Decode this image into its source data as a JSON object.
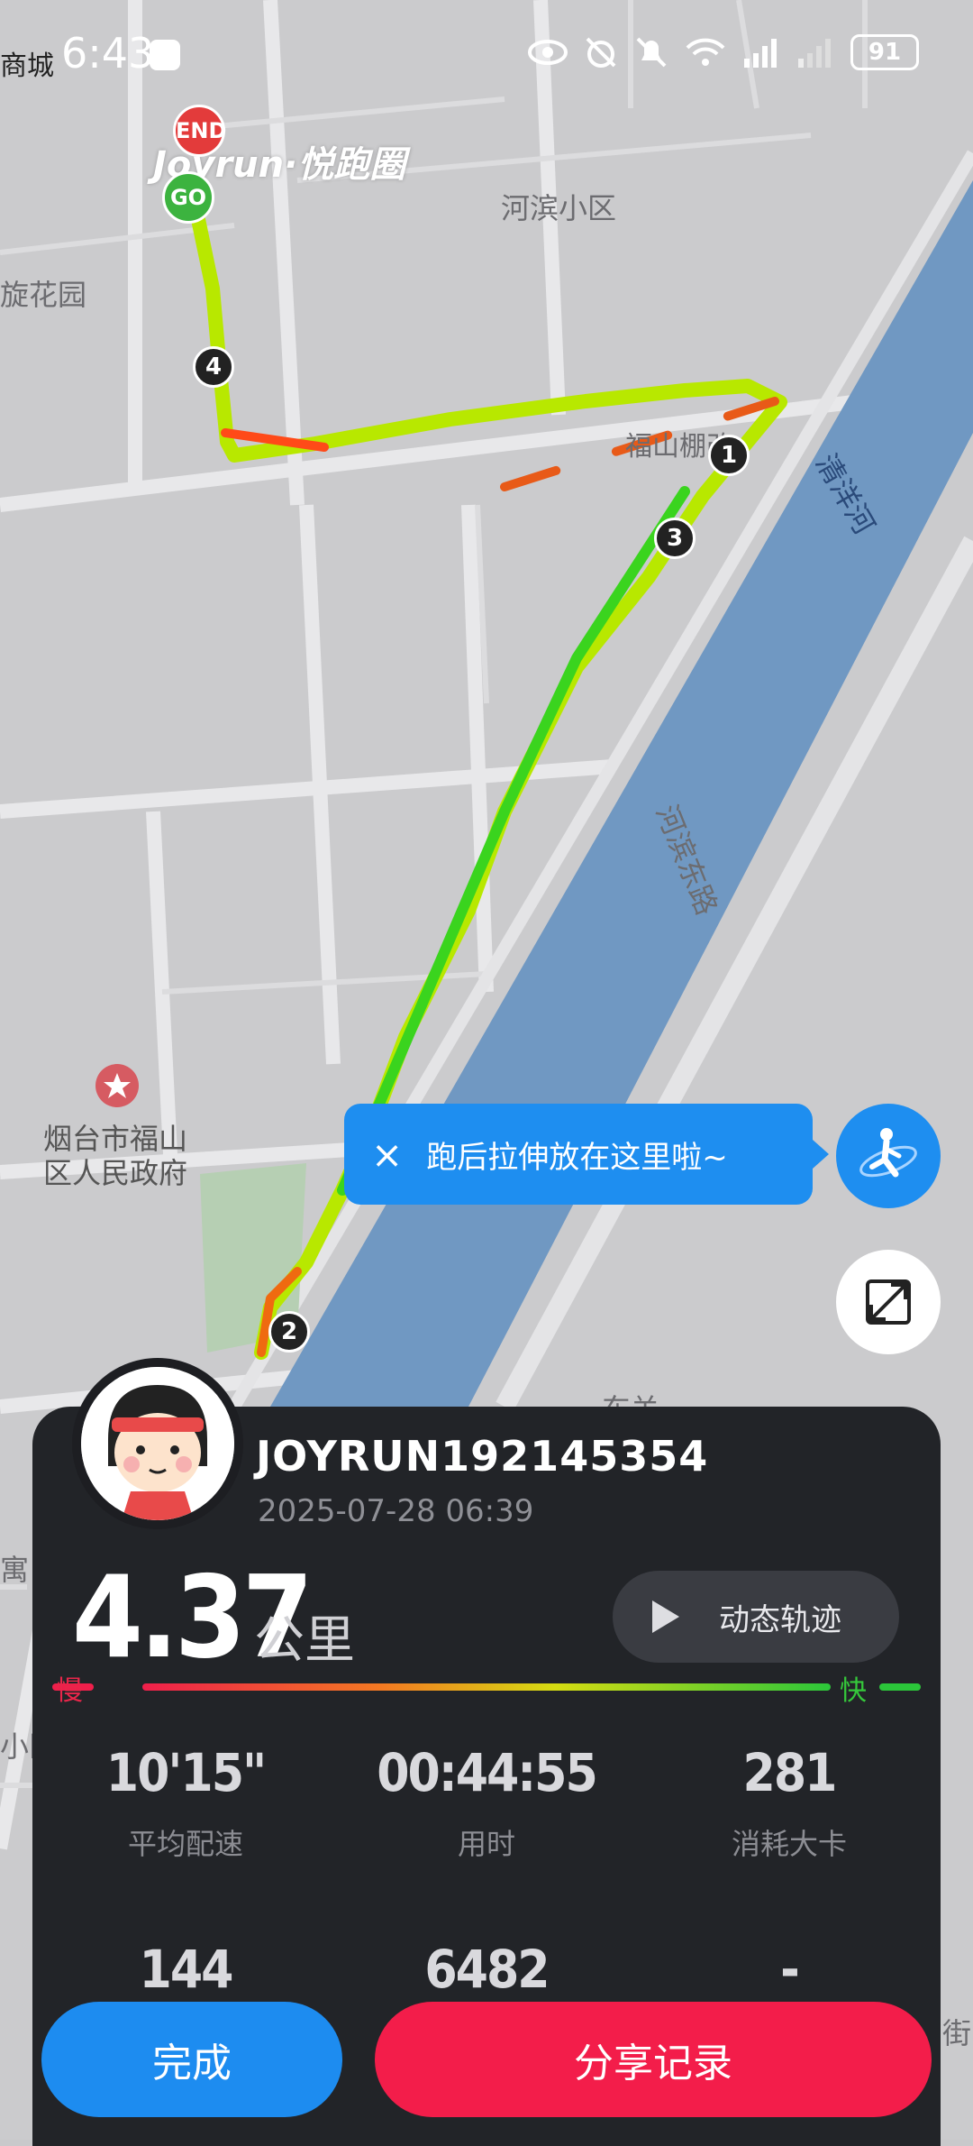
{
  "status_bar": {
    "time": "6:43",
    "left_label": "商城",
    "battery": "91"
  },
  "map": {
    "labels": [
      "河滨小区",
      "旋花园",
      "福山棚改",
      "清洋河",
      "河滨东路",
      "烟台市福山",
      "区人民政府",
      "东关",
      "寓",
      "小区",
      "街"
    ],
    "brand": "Joyrun·悦跑圈",
    "end_marker": "END",
    "go_marker": "GO",
    "km_markers": [
      "1",
      "2",
      "3",
      "4"
    ]
  },
  "tooltip": {
    "close": "×",
    "text": "跑后拉伸放在这里啦~"
  },
  "panel": {
    "username": "JOYRUN192145354",
    "datetime": "2025-07-28 06:39",
    "distance": "4.37",
    "distance_unit": "公里",
    "replay_label": "动态轨迹",
    "pace_slow": "慢",
    "pace_fast": "快",
    "stats": [
      {
        "value": "10'15\"",
        "label": "平均配速"
      },
      {
        "value": "00:44:55",
        "label": "用时"
      },
      {
        "value": "281",
        "label": "消耗大卡"
      },
      {
        "value": "144",
        "label": ""
      },
      {
        "value": "6482",
        "label": ""
      },
      {
        "value": "-",
        "label": ""
      }
    ]
  },
  "actions": {
    "done": "完成",
    "share": "分享记录"
  },
  "colors": {
    "accent_blue": "#1d8cf0",
    "share_red": "#f31d4a",
    "panel_bg": "#222428",
    "river": "#7098c2"
  }
}
